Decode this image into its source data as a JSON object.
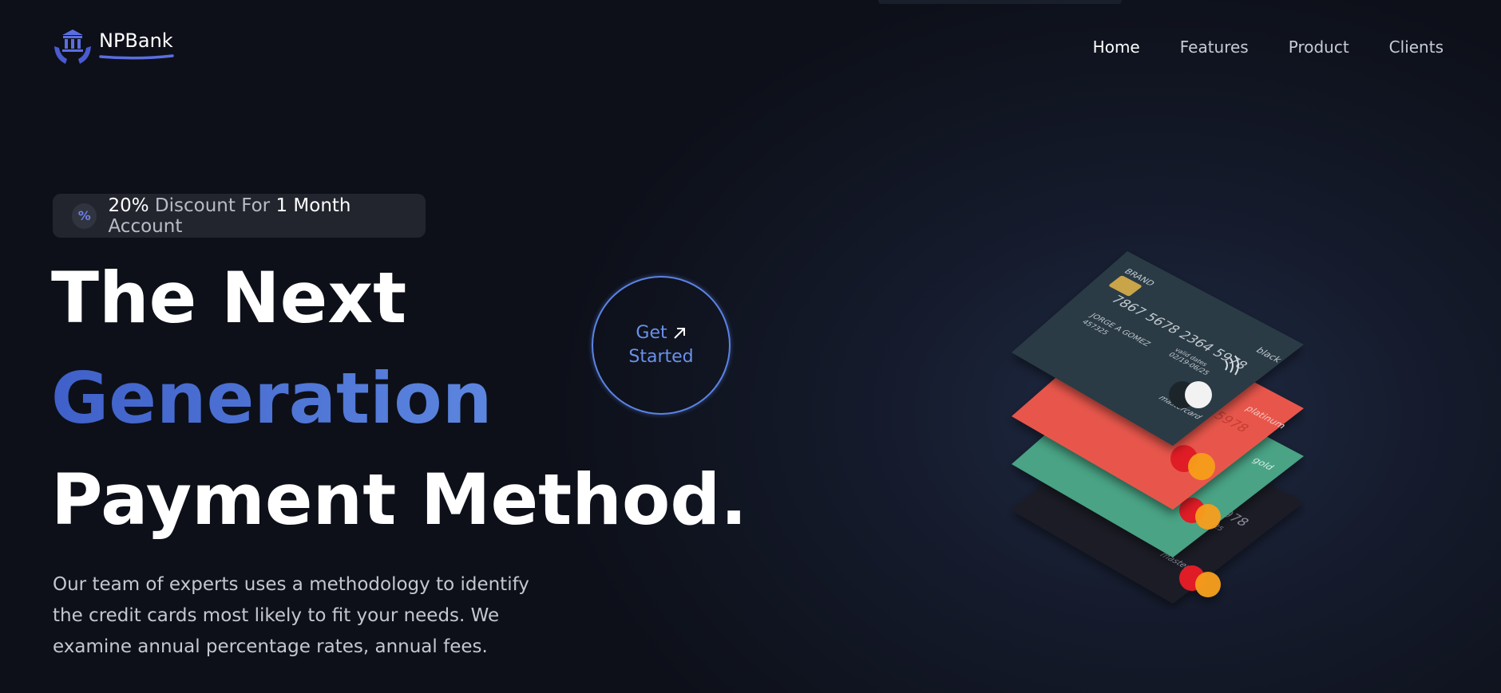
{
  "brand": {
    "name": "NPBank"
  },
  "nav": {
    "items": [
      "Home",
      "Features",
      "Product",
      "Clients"
    ],
    "active": "Home"
  },
  "badge": {
    "icon": "percent-icon",
    "pct": "20%",
    "t1": "Discount For",
    "month": "1 Month",
    "t2": "Account"
  },
  "hero": {
    "line1": "The Next",
    "line2": "Generation",
    "line3": "Payment Method.",
    "description_1": "Our team of experts uses a methodology to identify",
    "description_2": "the credit cards most likely to fit your needs. We",
    "description_3": "examine annual percentage rates, annual fees."
  },
  "cta": {
    "line1": "Get",
    "line2": "Started",
    "icon": "arrow-up-right-icon"
  },
  "cards": {
    "card_number": "7867 5678 2364 5978",
    "holder": "JORGE A GOMEZ",
    "expiry": "02/19-06/25",
    "code": "457325",
    "valid_label": "valid dates",
    "network": "mastercard",
    "brand_label": "BRAND",
    "tiers": [
      "black",
      "platinum",
      "gold"
    ]
  },
  "colors": {
    "accent": "#5b84e6",
    "card_dark": "#2b3a45",
    "card_red": "#e8564b",
    "card_green": "#4aa384",
    "card_black": "#1c1f26"
  }
}
